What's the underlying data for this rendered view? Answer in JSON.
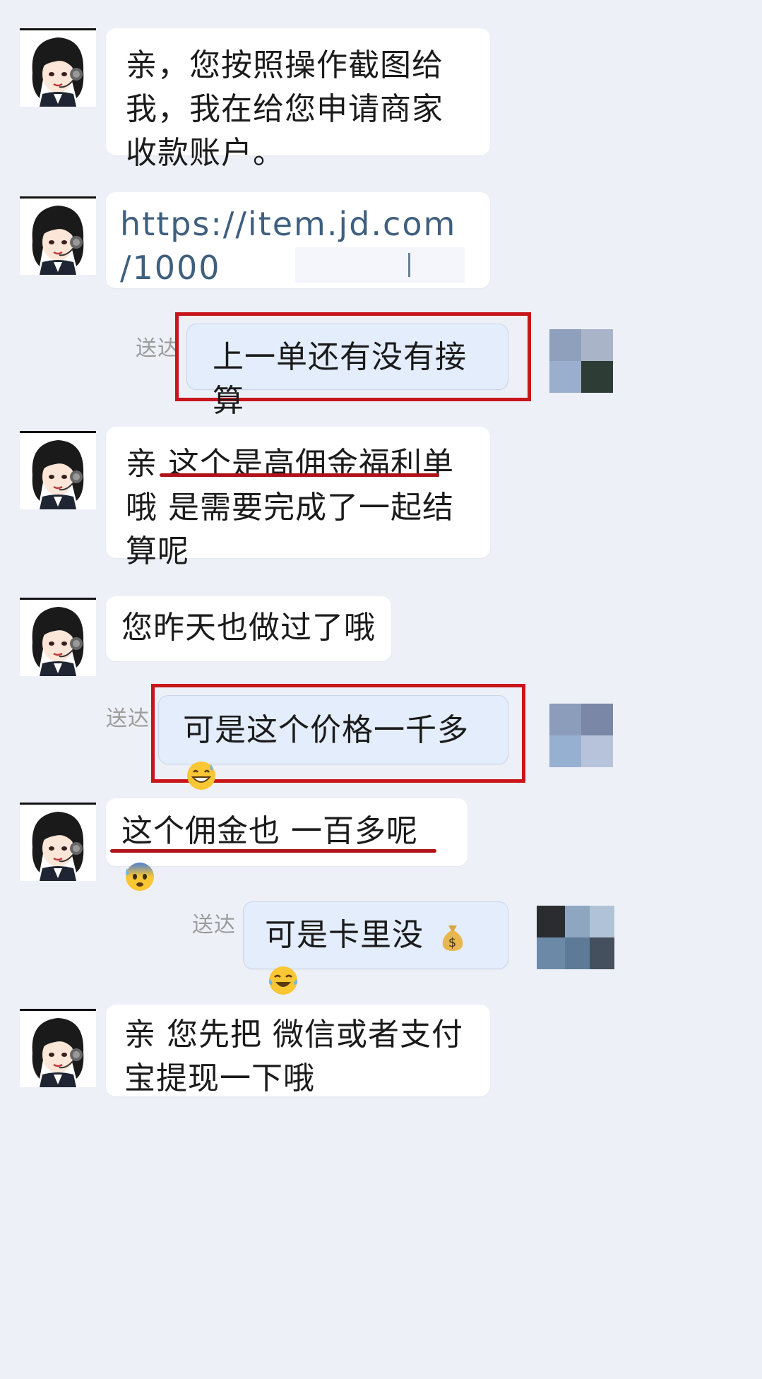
{
  "conversation": {
    "messages": [
      {
        "side": "incoming",
        "text": "亲，您按照操作截图给我，我在给您申请商家收款账户。"
      },
      {
        "side": "incoming",
        "text_line1": "https://item.jd.com",
        "text_line2": "/1000"
      },
      {
        "side": "outgoing",
        "status": "送达",
        "text": "上一单还有没有接算"
      },
      {
        "side": "incoming",
        "text_pre": "亲 ",
        "text_underlined": "这个是高佣金福利单",
        "text_post": "哦   是需要完成了一起结算呢"
      },
      {
        "side": "incoming",
        "text": "您昨天也做过了哦"
      },
      {
        "side": "outgoing",
        "status": "送达",
        "text": "可是这个价格一千多",
        "emoji": "grinning-sweat-icon"
      },
      {
        "side": "incoming",
        "text": "这个佣金也 一百多呢",
        "emoji": "anxious-sweat-icon"
      },
      {
        "side": "outgoing",
        "status": "送达",
        "text": "可是卡里没",
        "emoji": "money-bag-icon",
        "emoji2": "tears-of-joy-icon"
      },
      {
        "side": "incoming",
        "text": "亲  您先把 微信或者支付宝提现一下哦"
      }
    ]
  },
  "colors": {
    "background": "#eef0f8",
    "incoming_bubble": "#ffffff",
    "outgoing_bubble": "#e3edfb",
    "annotation_red": "#c8141b",
    "link": "#3f5f7f"
  }
}
